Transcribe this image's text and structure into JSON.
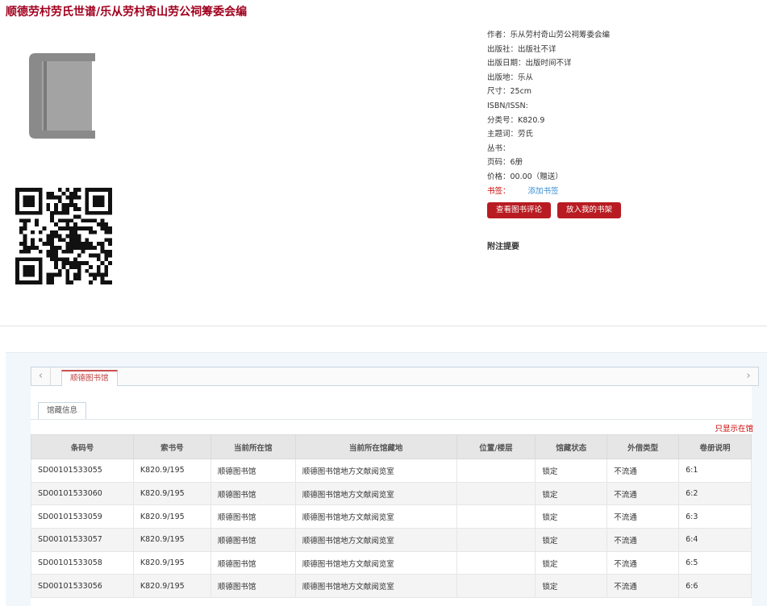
{
  "book": {
    "title": "顺德劳村劳氏世谱",
    "author_sep": "/",
    "author": "乐从劳村奇山劳公祠筹委会编"
  },
  "meta": {
    "author_line": "作者：乐从劳村奇山劳公祠筹委会编",
    "publisher_line": "出版社：出版社不详",
    "pubdate_line": "出版日期：出版时间不详",
    "place_line": "出版地：乐从",
    "size_line": "尺寸：25cm",
    "isbn_line": "ISBN/ISSN:",
    "class_line": "分类号：K820.9",
    "subject_line": "主题词：劳氏",
    "series_line": "丛书：",
    "pages_line": "页码：6册",
    "price_line": "价格：00.00（赠送）",
    "bookmark_label": "书签：",
    "bookmark_link": "添加书签"
  },
  "buttons": {
    "review": "查看图书评论",
    "shelf": "放入我的书架"
  },
  "notes": {
    "title": "附注提要"
  },
  "library_tab": {
    "label": "顺德图书馆",
    "subtab": "馆藏信息",
    "only_show": "只显示在馆"
  },
  "icons": {
    "left_arrow": "chevron-left-icon",
    "right_arrow": "chevron-right-icon",
    "book": "book-icon",
    "qr": "qr-code-icon"
  },
  "holdings": {
    "columns": [
      "条码号",
      "索书号",
      "当前所在馆",
      "当前所在馆藏地",
      "位置/楼层",
      "馆藏状态",
      "外借类型",
      "卷册说明"
    ],
    "rows": [
      [
        "SD00101533055",
        "K820.9/195",
        "顺德图书馆",
        "顺德图书馆地方文献阅览室",
        "",
        "锁定",
        "不流通",
        "6:1"
      ],
      [
        "SD00101533060",
        "K820.9/195",
        "顺德图书馆",
        "顺德图书馆地方文献阅览室",
        "",
        "锁定",
        "不流通",
        "6:2"
      ],
      [
        "SD00101533059",
        "K820.9/195",
        "顺德图书馆",
        "顺德图书馆地方文献阅览室",
        "",
        "锁定",
        "不流通",
        "6:3"
      ],
      [
        "SD00101533057",
        "K820.9/195",
        "顺德图书馆",
        "顺德图书馆地方文献阅览室",
        "",
        "锁定",
        "不流通",
        "6:4"
      ],
      [
        "SD00101533058",
        "K820.9/195",
        "顺德图书馆",
        "顺德图书馆地方文献阅览室",
        "",
        "锁定",
        "不流通",
        "6:5"
      ],
      [
        "SD00101533056",
        "K820.9/195",
        "顺德图书馆",
        "顺德图书馆地方文献阅览室",
        "",
        "锁定",
        "不流通",
        "6:6"
      ]
    ]
  },
  "colors": {
    "title": "#a1001e",
    "button": "#b81c22",
    "link": "#3a8fd0"
  }
}
